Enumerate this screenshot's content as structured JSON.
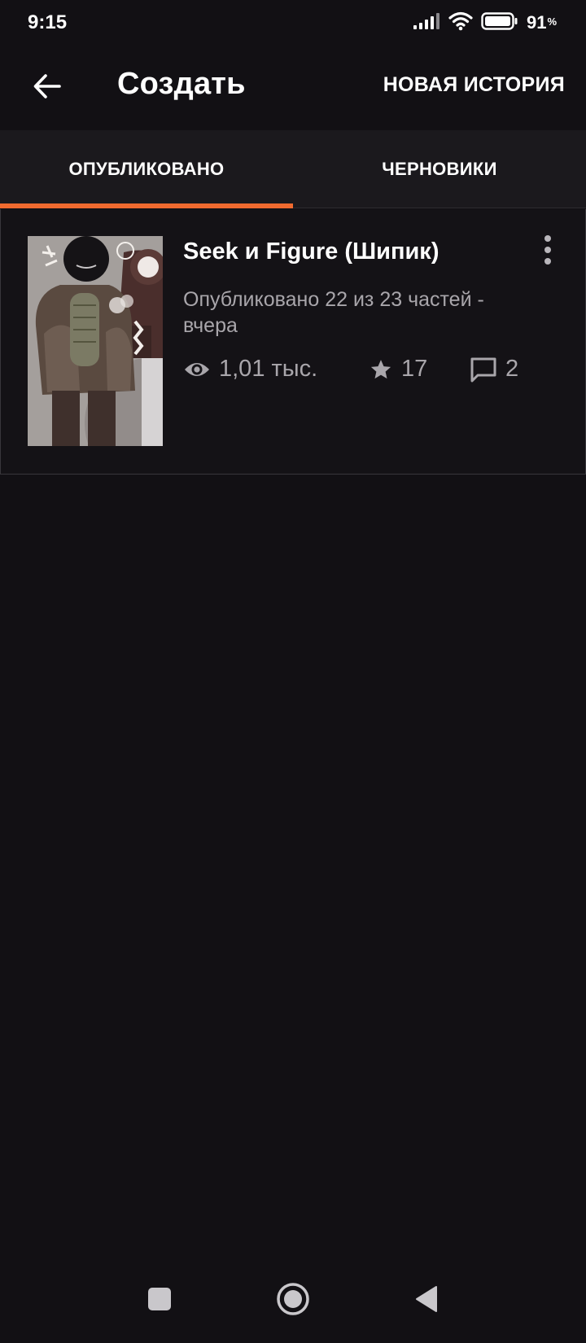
{
  "status_bar": {
    "time": "9:15",
    "battery_percent": "91",
    "battery_percent_sign": "%",
    "icons": [
      "signal-icon",
      "wifi-icon",
      "battery-icon"
    ]
  },
  "app_bar": {
    "title": "Создать",
    "new_story_label": "НОВАЯ ИСТОРИЯ"
  },
  "tabs": [
    {
      "label": "ОПУБЛИКОВАНО",
      "active": true
    },
    {
      "label": "ЧЕРНОВИКИ",
      "active": false
    }
  ],
  "accent_color": "#f06a2f",
  "stories": [
    {
      "title": "Seek и Figure (Шипик)",
      "meta_line1": "Опубликовано 22 из 23 частей -",
      "meta_line2": "вчера",
      "views": "1,01 тыс.",
      "votes": "17",
      "comments": "2"
    }
  ]
}
